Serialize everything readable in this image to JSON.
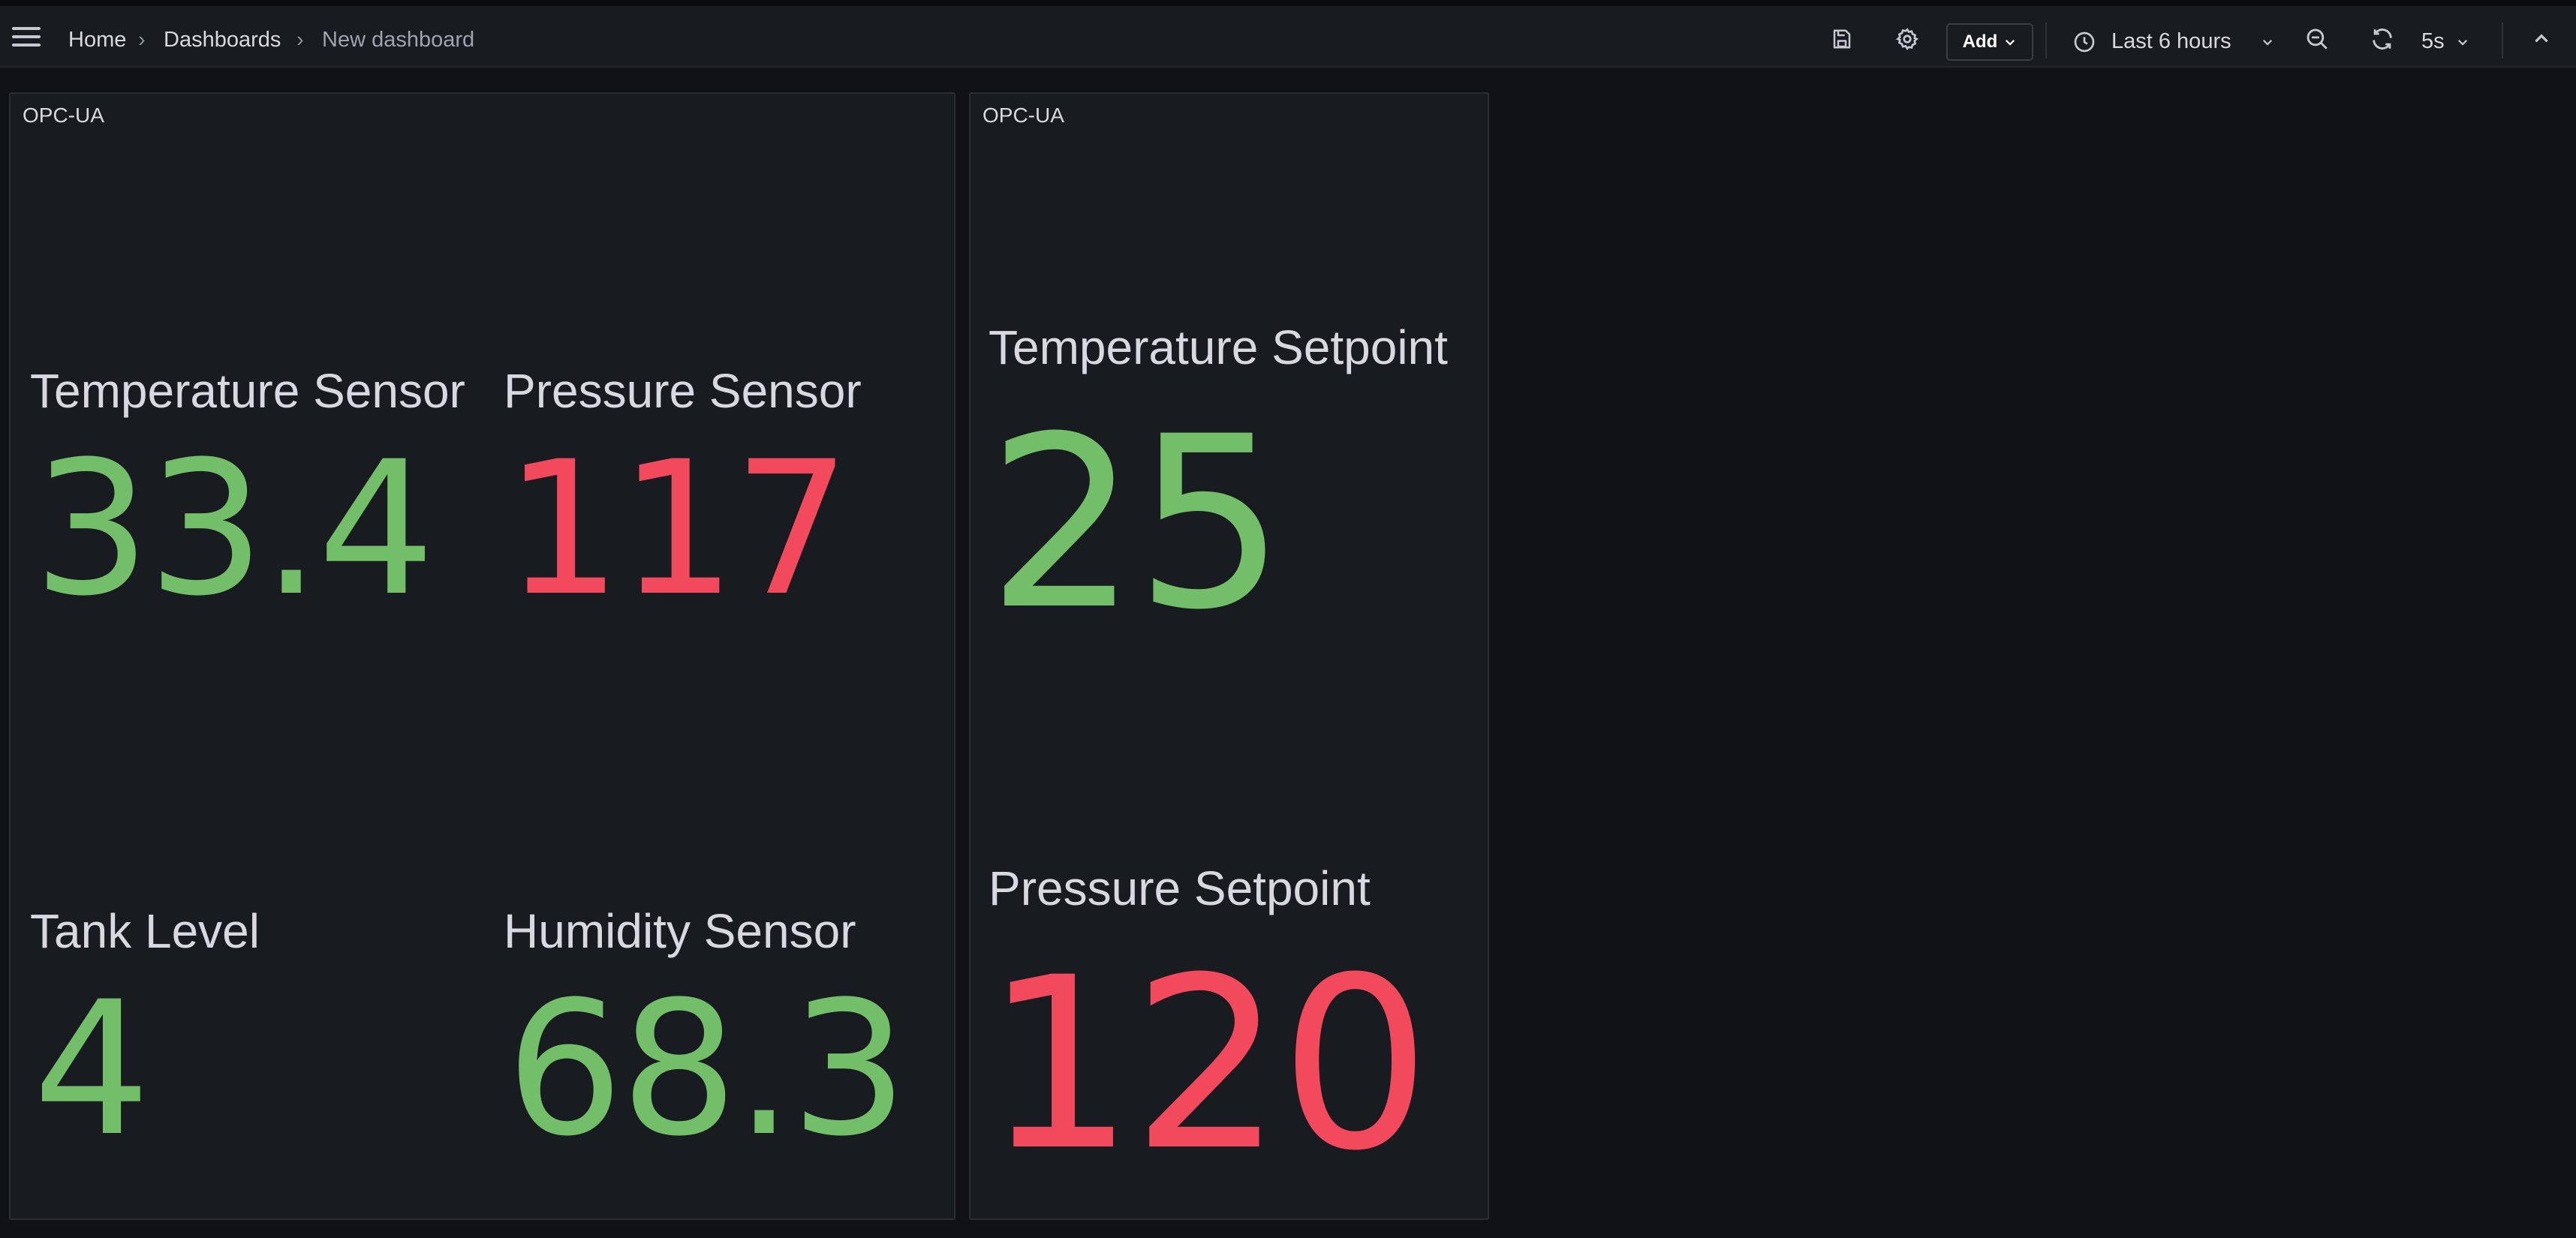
{
  "topbar": {
    "breadcrumb": {
      "home": "Home",
      "dashboards": "Dashboards",
      "current": "New dashboard",
      "separator": "›"
    },
    "add_label": "Add",
    "time_range": "Last 6 hours",
    "refresh_interval": "5s",
    "icons": [
      "menu-icon",
      "save-icon",
      "gear-icon",
      "chevron-down-icon",
      "clock-icon",
      "zoom-out-icon",
      "refresh-icon",
      "chevron-up-icon"
    ]
  },
  "panels": [
    {
      "title": "OPC-UA",
      "stats": [
        {
          "name": "Temperature Sensor",
          "value": "33.4",
          "color": "#73bf69"
        },
        {
          "name": "Pressure Sensor",
          "value": "117",
          "color": "#f2495c"
        },
        {
          "name": "Tank Level",
          "value": "4",
          "color": "#73bf69"
        },
        {
          "name": "Humidity Sensor",
          "value": "68.3",
          "color": "#73bf69"
        }
      ]
    },
    {
      "title": "OPC-UA",
      "stats": [
        {
          "name": "Temperature Setpoint",
          "value": "25",
          "color": "#73bf69"
        },
        {
          "name": "Pressure Setpoint",
          "value": "120",
          "color": "#f2495c"
        }
      ]
    }
  ]
}
